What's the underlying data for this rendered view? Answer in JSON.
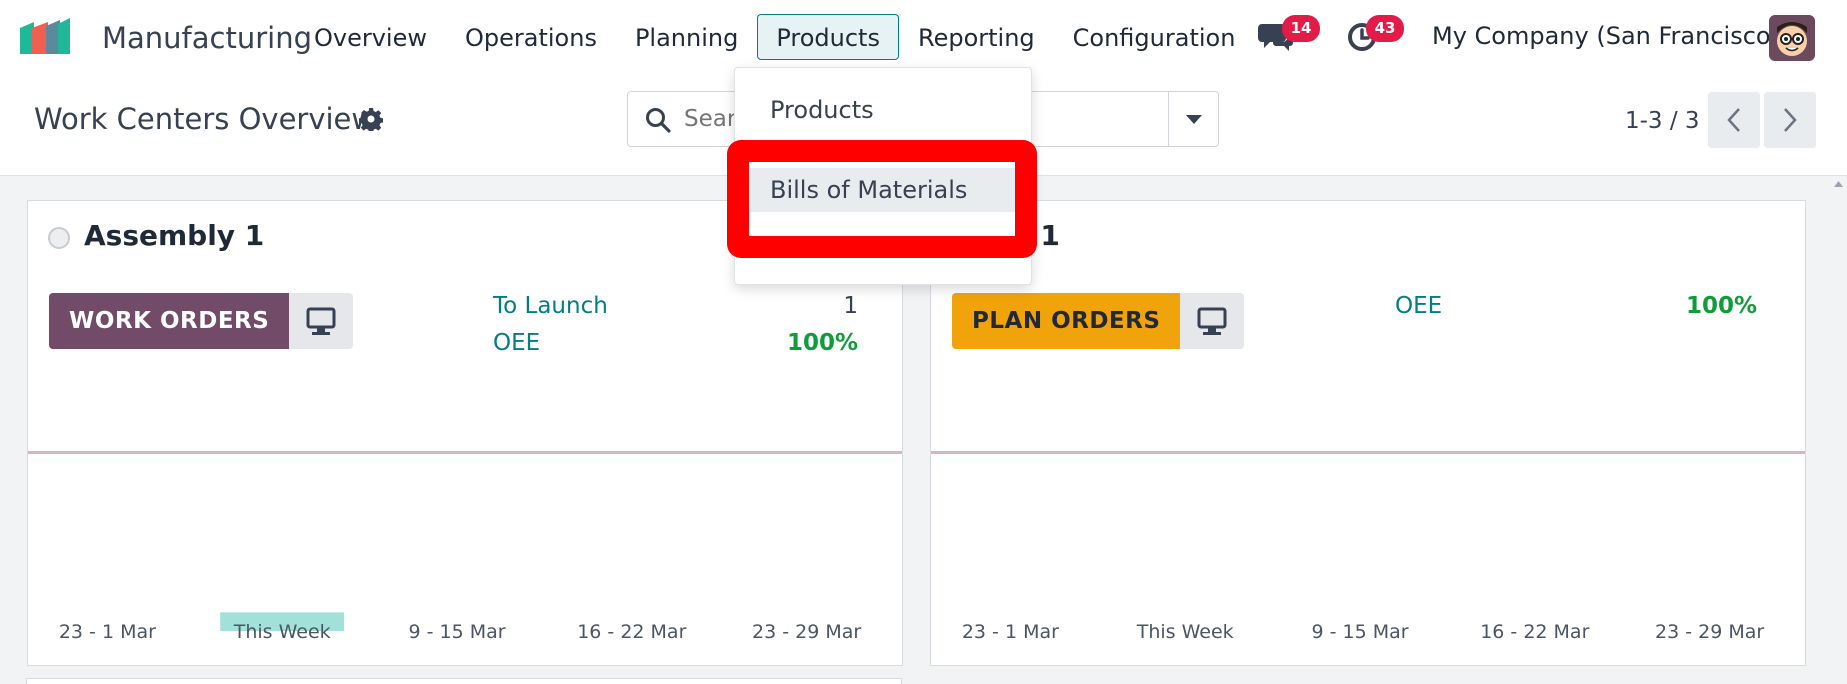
{
  "app": {
    "name": "Manufacturing"
  },
  "nav": {
    "items": [
      "Overview",
      "Operations",
      "Planning",
      "Products",
      "Reporting",
      "Configuration"
    ],
    "active": "Products"
  },
  "systray": {
    "messages_count": "14",
    "activities_count": "43",
    "company": "My Company (San Francisco)"
  },
  "control": {
    "title": "Work Centers Overview",
    "search_placeholder": "Search...",
    "pager": "1-3 / 3"
  },
  "dropdown": {
    "items": [
      "Products",
      "Bills of Materials"
    ]
  },
  "cards": [
    {
      "title": "Assembly 1",
      "primary_button": "WORK ORDERS",
      "stats": [
        {
          "label": "To Launch",
          "value": "1"
        },
        {
          "label": "OEE",
          "value": "100%"
        }
      ]
    },
    {
      "title": "l 1",
      "primary_button": "PLAN ORDERS",
      "stats": [
        {
          "label": "OEE",
          "value": "100%"
        }
      ]
    }
  ],
  "chart_data": [
    {
      "type": "bar",
      "categories": [
        "23 - 1 Mar",
        "This Week",
        "9 - 15 Mar",
        "16 - 22 Mar",
        "23 - 29 Mar"
      ],
      "values": [
        0,
        0.15,
        0,
        0,
        0
      ],
      "colors": {
        "bar": "#a2e1d8",
        "line": "#d9b4c6"
      }
    },
    {
      "type": "bar",
      "categories": [
        "23 - 1 Mar",
        "This Week",
        "9 - 15 Mar",
        "16 - 22 Mar",
        "23 - 29 Mar"
      ],
      "values": [
        0,
        0,
        0,
        0,
        0
      ],
      "colors": {
        "bar": "#a2e1d8",
        "line": "#d9b4c6"
      }
    }
  ],
  "colors": {
    "brand": "#017e84",
    "work_orders_btn": "#714b67",
    "plan_orders_btn": "#f0a30a",
    "badge": "#e31b48",
    "highlight": "#ff0000",
    "success": "#0d9e3a"
  },
  "icons": {
    "messages": "chat-bubbles-icon",
    "activities": "clock-icon",
    "settings": "gear-icon",
    "search": "search-icon",
    "workstation": "desktop-icon"
  }
}
